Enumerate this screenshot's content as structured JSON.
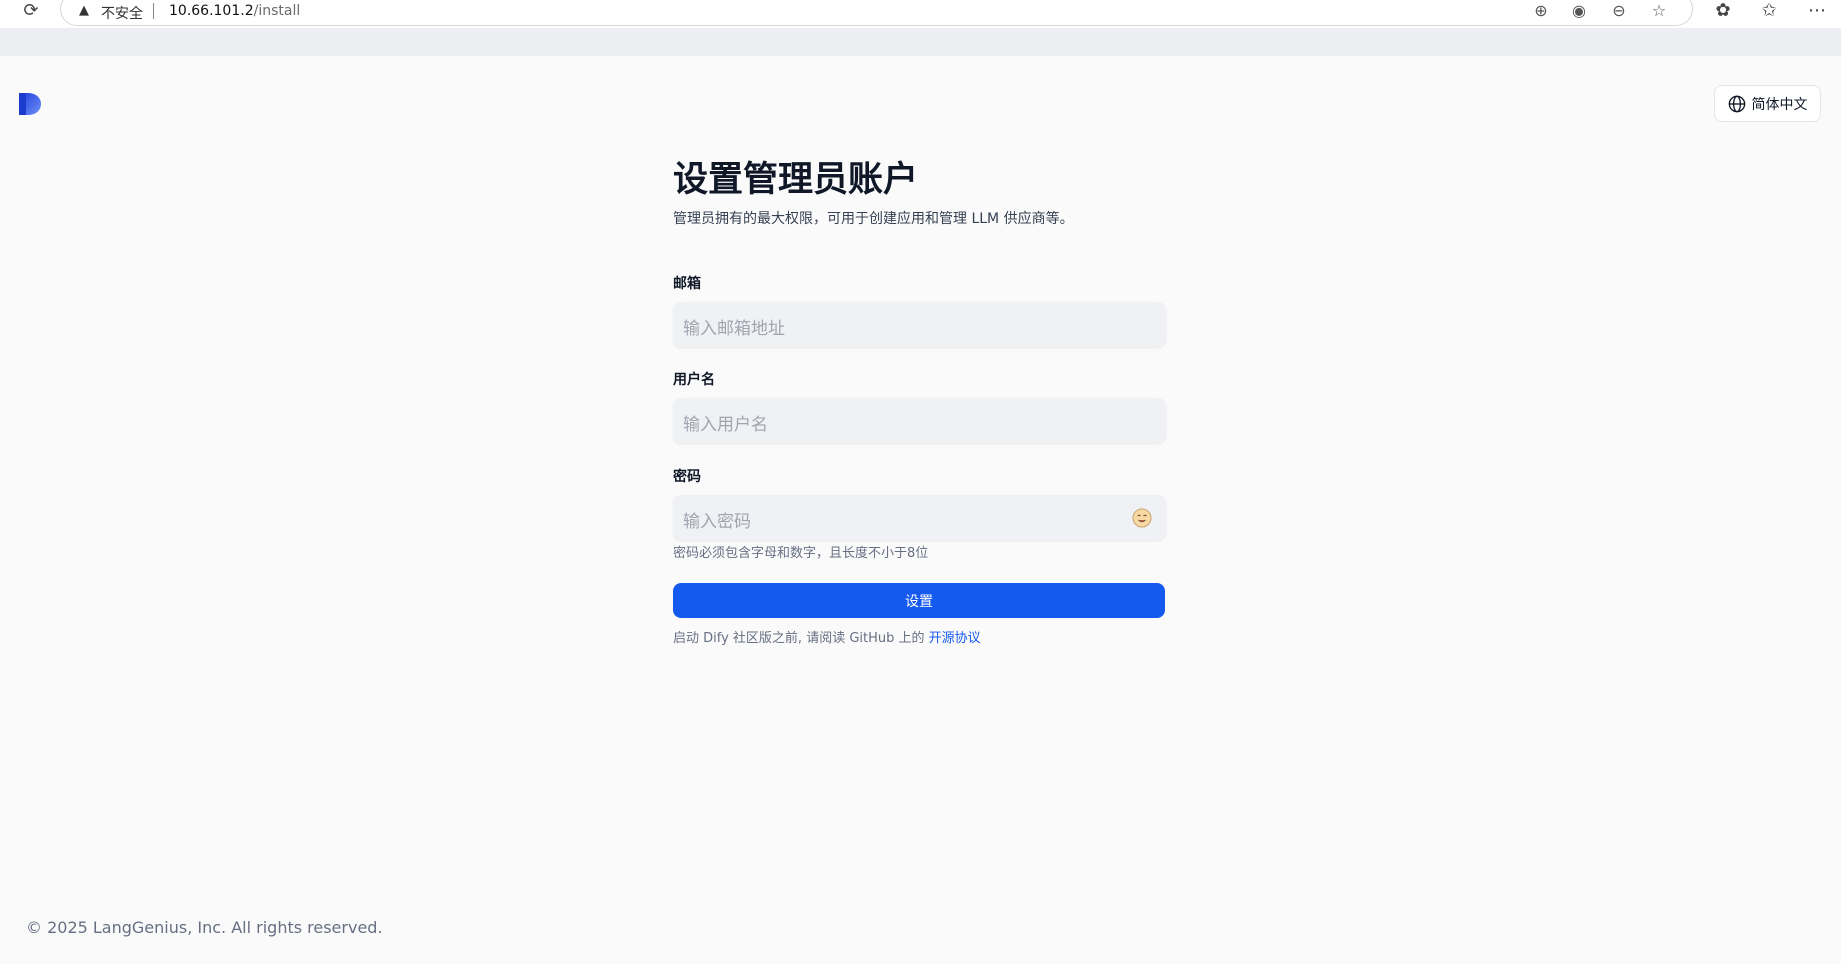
{
  "browser": {
    "security_label": "不安全",
    "url_host": "10.66.101.2",
    "url_path": "/install"
  },
  "header": {
    "language_label": "简体中文"
  },
  "form": {
    "title": "设置管理员账户",
    "subtitle": "管理员拥有的最大权限，可用于创建应用和管理 LLM 供应商等。",
    "email_label": "邮箱",
    "email_placeholder": "输入邮箱地址",
    "username_label": "用户名",
    "username_placeholder": "输入用户名",
    "password_label": "密码",
    "password_placeholder": "输入密码",
    "password_hint": "密码必须包含字母和数字，且长度不小于8位",
    "submit_label": "设置",
    "agreement_prefix": "启动 Dify 社区版之前, 请阅读 GitHub 上的 ",
    "agreement_link": "开源协议"
  },
  "footer": {
    "copyright": "© 2025 LangGenius, Inc. All rights reserved."
  },
  "colors": {
    "primary": "#155aef",
    "background": "#fafafa",
    "input_bg": "#eff1f5"
  }
}
